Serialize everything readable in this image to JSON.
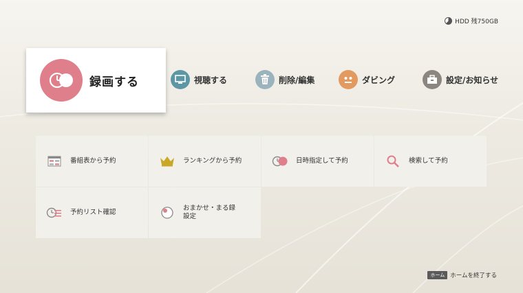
{
  "status": {
    "hdd_text": "HDD 残750GB",
    "hdd_remaining_fraction": 0.62
  },
  "nav": {
    "main": {
      "label": "録画する",
      "icon": "record-timer-icon",
      "color": "#df7f8b"
    },
    "items": [
      {
        "label": "視聴する",
        "icon": "tv-icon",
        "color": "#5c97a3"
      },
      {
        "label": "削除/編集",
        "icon": "trash-icon",
        "color": "#9bb3bd"
      },
      {
        "label": "ダビング",
        "icon": "dubbing-icon",
        "color": "#e39a60"
      },
      {
        "label": "設定/お知らせ",
        "icon": "toolbox-icon",
        "color": "#8c8680"
      }
    ]
  },
  "tiles": [
    {
      "label": "番組表から予約",
      "icon": "program-guide-icon"
    },
    {
      "label": "ランキングから予約",
      "icon": "crown-icon"
    },
    {
      "label": "日時指定して予約",
      "icon": "timer-icon"
    },
    {
      "label": "検索して予約",
      "icon": "search-icon"
    },
    {
      "label": "予約リスト確認",
      "icon": "reservation-list-icon"
    },
    {
      "label": "おまかせ・まる録\n設定",
      "icon": "auto-record-icon"
    }
  ],
  "footer": {
    "key_label": "ホーム",
    "text": "ホームを終了する"
  }
}
